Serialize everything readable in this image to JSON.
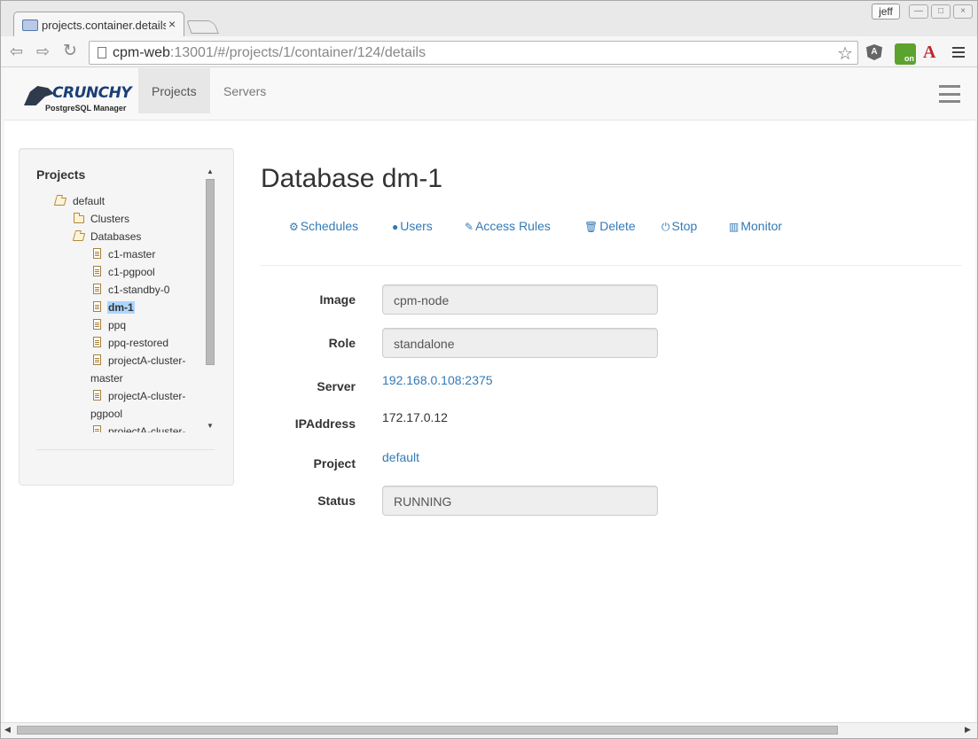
{
  "browser": {
    "tab_title": "projects.container.details",
    "tab_close": "×",
    "user": "jeff",
    "url_host": "cpm-web",
    "url_rest": ":13001/#/projects/1/container/124/details",
    "extension_labels": {
      "angular": "A",
      "on_badge": "on",
      "acrobat": "A"
    }
  },
  "app": {
    "logo_text": "CRUNCHY",
    "logo_sub": "PostgreSQL Manager",
    "nav": [
      {
        "label": "Projects",
        "active": true
      },
      {
        "label": "Servers",
        "active": false
      }
    ]
  },
  "sidebar": {
    "title": "Projects",
    "tree": [
      {
        "label": "default",
        "icon": "folder-open-icon"
      },
      {
        "label": "Clusters",
        "icon": "folder-icon"
      },
      {
        "label": "Databases",
        "icon": "folder-open-icon"
      },
      {
        "label": "c1-master",
        "icon": "file-icon"
      },
      {
        "label": "c1-pgpool",
        "icon": "file-icon"
      },
      {
        "label": "c1-standby-0",
        "icon": "file-icon"
      },
      {
        "label": "dm-1",
        "icon": "file-icon",
        "selected": true
      },
      {
        "label": "ppq",
        "icon": "file-icon"
      },
      {
        "label": "ppq-restored",
        "icon": "file-icon"
      },
      {
        "label": "projectA-cluster-",
        "label_cont": "master",
        "icon": "file-icon"
      },
      {
        "label": "projectA-cluster-",
        "label_cont": "pgpool",
        "icon": "file-icon"
      },
      {
        "label": "projectA-cluster-",
        "icon": "file-icon"
      }
    ]
  },
  "main": {
    "title": "Database dm-1",
    "actions": [
      {
        "label": "Schedules",
        "icon": "cogs-icon"
      },
      {
        "label": "Users",
        "icon": "user-icon"
      },
      {
        "label": "Access Rules",
        "icon": "edit-icon"
      },
      {
        "label": "Delete",
        "icon": "trash-icon"
      },
      {
        "label": "Stop",
        "icon": "power-icon"
      },
      {
        "label": "Monitor",
        "icon": "bar-chart-icon"
      }
    ],
    "fields": {
      "image": {
        "label": "Image",
        "value": "cpm-node"
      },
      "role": {
        "label": "Role",
        "value": "standalone"
      },
      "server": {
        "label": "Server",
        "value": "192.168.0.108:2375"
      },
      "ipaddress": {
        "label": "IPAddress",
        "value": "172.17.0.12"
      },
      "project": {
        "label": "Project",
        "value": "default"
      },
      "status": {
        "label": "Status",
        "value": "RUNNING"
      }
    }
  },
  "colors": {
    "link": "#337ab7",
    "selected_highlight": "#acd6ff",
    "navbar_bg": "#f8f8f8"
  }
}
